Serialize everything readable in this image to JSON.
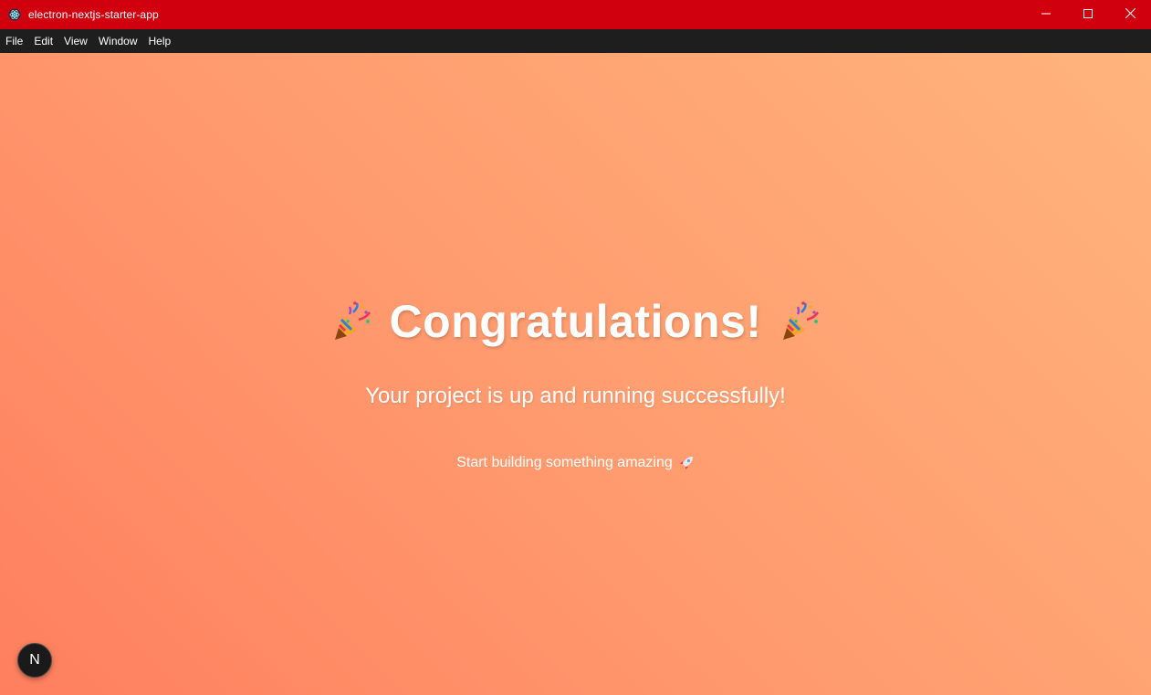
{
  "window": {
    "title": "electron-nextjs-starter-app",
    "controls": {
      "minimize": "minimize-icon",
      "maximize": "maximize-icon",
      "close": "close-icon"
    }
  },
  "menu": {
    "items": [
      "File",
      "Edit",
      "View",
      "Window",
      "Help"
    ]
  },
  "main": {
    "headline": "Congratulations!",
    "headline_icon": "party-popper-icon",
    "subtitle": "Your project is up and running successfully!",
    "tagline": "Start building something amazing",
    "tagline_icon": "rocket-icon"
  },
  "dev_indicator": {
    "label": "N"
  },
  "colors": {
    "titlebar": "#d0000e",
    "menubar": "#1e1e1e",
    "gradient_start": "#ff7f5e",
    "gradient_end": "#ffb47c",
    "text": "#ffffff"
  }
}
